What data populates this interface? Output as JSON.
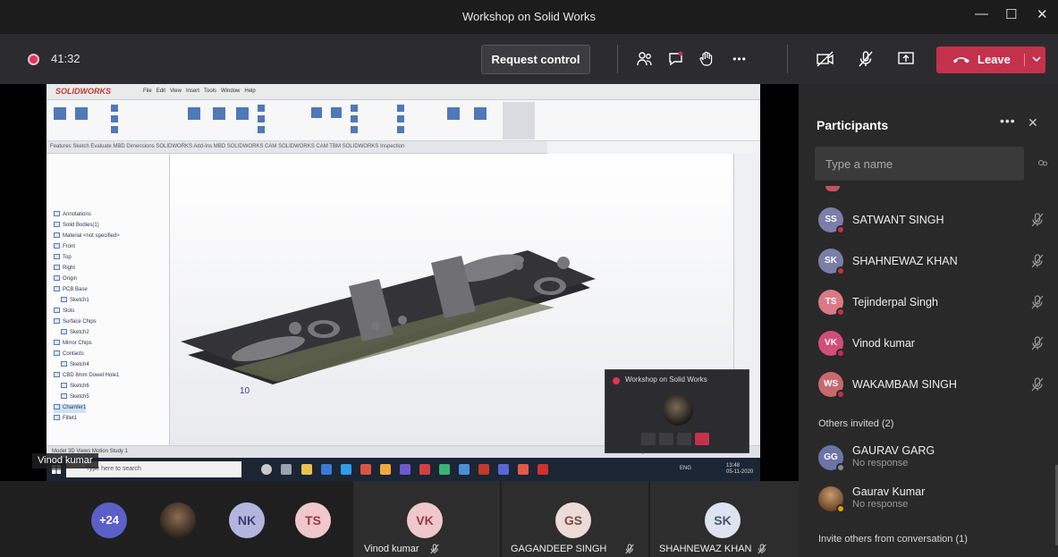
{
  "window": {
    "title": "Workshop on Solid Works",
    "controls": [
      "—",
      "☐",
      "✕"
    ]
  },
  "toolbar": {
    "timer": "41:32",
    "request_control": "Request control",
    "leave": "Leave",
    "more": "•••"
  },
  "share": {
    "presenter_label": "Vinod kumar",
    "app_brand": "SOLIDWORKS",
    "menu": [
      "File",
      "Edit",
      "View",
      "Insert",
      "Tools",
      "Window",
      "Help"
    ],
    "tabs": "Features   Sketch   Evaluate   MBD Dimensions   SOLIDWORKS Add-Ins   MBD   SOLIDWORKS CAM   SOLIDWORKS CAM TBM   SOLIDWORKS Inspection",
    "tree": [
      "Annotations",
      "Solid Bodies(1)",
      "Material <not specified>",
      "Front",
      "Top",
      "Right",
      "Origin",
      "PCB Base",
      "Sketch1",
      "Slots",
      "Surface Chips",
      "Sketch2",
      "Mirror Chips",
      "Contacts",
      "Sketch4",
      "CBD 8mm Dowel Hole1",
      "Sketch6",
      "Sketch5",
      "Chamfer1",
      "Fillet1"
    ],
    "status": "Model   3D Views   Motion Study 1",
    "status_right": "Editing Part    MMGS",
    "taskbar_search": "Type here to search",
    "taskbar_time": "13:48",
    "taskbar_date": "05-11-2020",
    "taskbar_lang": "ENG"
  },
  "mini_window": {
    "title": "Workshop on Solid Works"
  },
  "participants": {
    "title": "Participants",
    "more": "•••",
    "search_placeholder": "Type a name",
    "people": [
      {
        "initials": "SS",
        "name": "SATWANT SINGH",
        "color": "#7b7fa8",
        "dot": "#c4314b"
      },
      {
        "initials": "SK",
        "name": "SHAHNEWAZ KHAN",
        "color": "#7b7fa8",
        "dot": "#c4314b"
      },
      {
        "initials": "TS",
        "name": "Tejinderpal Singh",
        "color": "#d97a86",
        "dot": "#c4314b"
      },
      {
        "initials": "VK",
        "name": "Vinod kumar",
        "color": "#d24d7a",
        "dot": "#c4314b"
      },
      {
        "initials": "WS",
        "name": "WAKAMBAM SINGH",
        "color": "#c9686f",
        "dot": "#c4314b"
      }
    ],
    "others_label": "Others invited (2)",
    "invited": [
      {
        "initials": "GG",
        "name": "GAURAV GARG",
        "status": "No response",
        "color": "#6c73a8",
        "dot": "#8b8b8b"
      },
      {
        "initials": "",
        "name": "Gaurav Kumar",
        "status": "No response",
        "color": "#a36a3c",
        "dot": "#e0a100"
      }
    ],
    "invite_conversation": "Invite others from conversation (1)"
  },
  "strip": {
    "overflow": "+24",
    "avatars": [
      {
        "initials": "NK",
        "color": "#b4b5df",
        "text": "#3d3e6e"
      },
      {
        "initials": "TS",
        "color": "#f0c7cd",
        "text": "#9b3744"
      }
    ],
    "tiles": [
      {
        "initials": "VK",
        "name": "Vinod kumar",
        "color": "#f0c7cd",
        "text": "#9b3744"
      },
      {
        "initials": "GS",
        "name": "GAGANDEEP SINGH",
        "color": "#ecdbd6",
        "text": "#7a4c40"
      },
      {
        "initials": "SK",
        "name": "SHAHNEWAZ KHAN",
        "color": "#dde4ef",
        "text": "#44566f"
      }
    ]
  }
}
